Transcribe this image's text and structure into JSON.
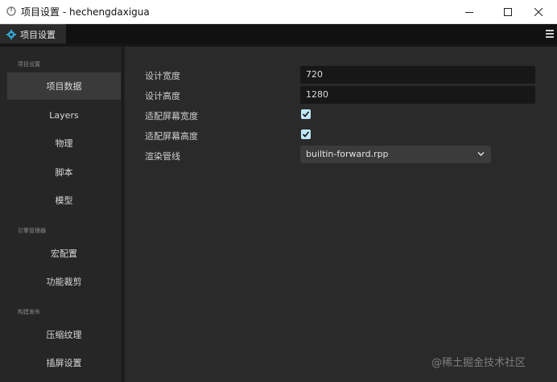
{
  "window": {
    "title": "项目设置 - hechengdaxigua"
  },
  "tabs": [
    {
      "label": "项目设置"
    }
  ],
  "sidebar": {
    "sections": [
      {
        "label": "项目设置"
      },
      {
        "label": "引擎管理器"
      },
      {
        "label": "构建发布"
      }
    ],
    "items": [
      {
        "label": "项目数据"
      },
      {
        "label": "Layers"
      },
      {
        "label": "物理"
      },
      {
        "label": "脚本"
      },
      {
        "label": "模型"
      },
      {
        "label": "宏配置"
      },
      {
        "label": "功能裁剪"
      },
      {
        "label": "压缩纹理"
      },
      {
        "label": "插屏设置"
      }
    ]
  },
  "settings": {
    "design_width": {
      "label": "设计宽度",
      "value": "720"
    },
    "design_height": {
      "label": "设计高度",
      "value": "1280"
    },
    "fit_width": {
      "label": "适配屏幕宽度",
      "checked": true
    },
    "fit_height": {
      "label": "适配屏幕高度",
      "checked": true
    },
    "render_pipeline": {
      "label": "渲染管线",
      "value": "builtin-forward.rpp"
    }
  },
  "watermark": "@稀土掘金技术社区",
  "colors": {
    "accent": "#2fa8d8",
    "checkbox": "#bfe7f7"
  }
}
